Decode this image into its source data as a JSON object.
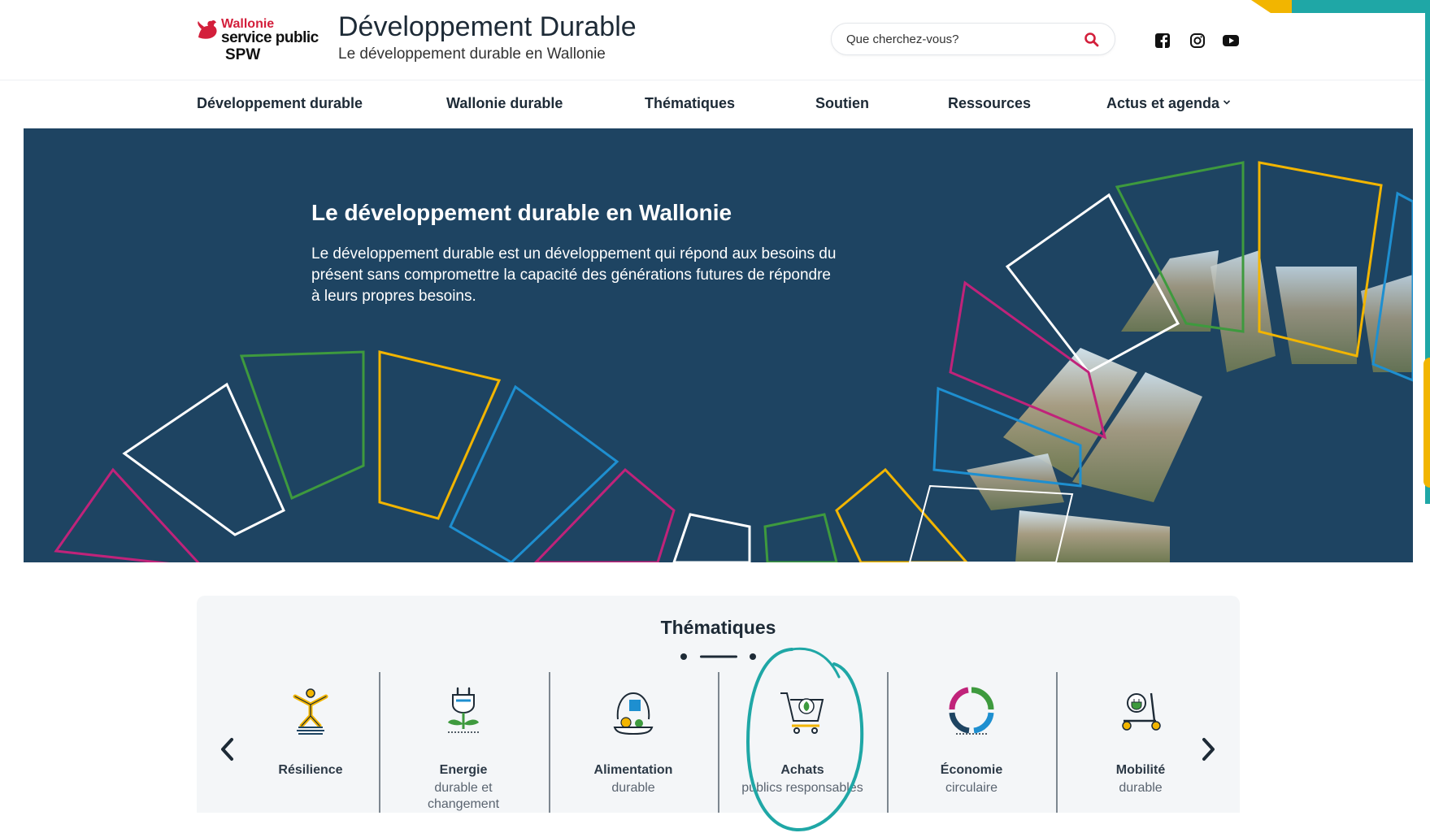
{
  "colors": {
    "hero_bg": "#1e4462",
    "teal": "#1fa7a6",
    "yellow": "#f2b500",
    "magenta": "#c0237a",
    "green": "#3e9a3e",
    "blue": "#1e8fd0",
    "wallonie_red": "#d31f3b"
  },
  "logo": {
    "line1": "Wallonie",
    "line2": "service public",
    "line3": "SPW"
  },
  "header": {
    "title": "Développement Durable",
    "subtitle": "Le développement durable en Wallonie",
    "search_placeholder": "Que cherchez-vous?",
    "search_icon": "search-icon",
    "social": [
      "facebook-icon",
      "instagram-icon",
      "youtube-icon"
    ]
  },
  "nav": {
    "items": [
      {
        "label": "Développement durable"
      },
      {
        "label": "Wallonie durable"
      },
      {
        "label": "Thématiques"
      },
      {
        "label": "Soutien"
      },
      {
        "label": "Ressources"
      },
      {
        "label": "Actus et agenda",
        "icon": "chevron-down-icon"
      }
    ]
  },
  "hero": {
    "title": "Le développement durable en Wallonie",
    "text": "Le développement durable est un développement qui répond aux besoins du présent sans compromettre la capacité des générations futures de répondre à leurs propres besoins."
  },
  "themes": {
    "title": "Thématiques",
    "prev_icon": "chevron-left-icon",
    "next_icon": "chevron-right-icon",
    "items": [
      {
        "title": "Résilience",
        "subtitle": "",
        "icon": "resilience-icon"
      },
      {
        "title": "Energie",
        "subtitle": "durable et changement climatique",
        "icon": "energy-plug-icon"
      },
      {
        "title": "Alimentation",
        "subtitle": "durable",
        "icon": "food-icon"
      },
      {
        "title": "Achats",
        "subtitle": "publics responsables",
        "icon": "shopping-cart-icon"
      },
      {
        "title": "Économie",
        "subtitle": "circulaire",
        "icon": "circular-economy-icon"
      },
      {
        "title": "Mobilité",
        "subtitle": "durable",
        "icon": "scooter-icon"
      }
    ]
  }
}
